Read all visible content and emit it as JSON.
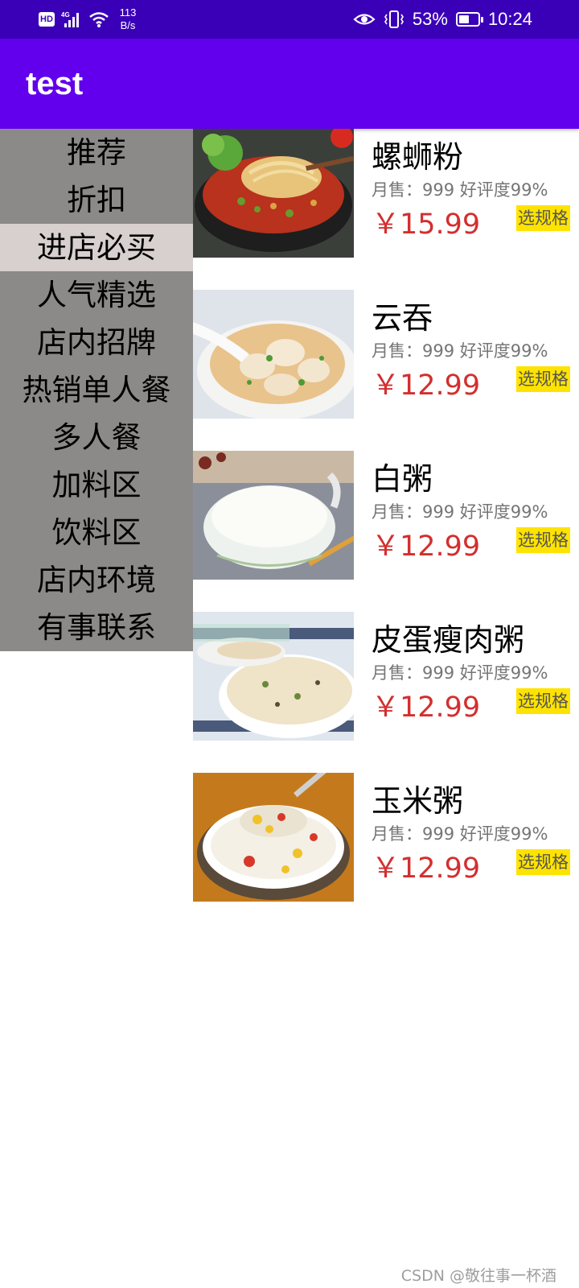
{
  "status_bar": {
    "hd": "HD",
    "net_speed_value": "113",
    "net_speed_unit": "B/s",
    "battery": "53%",
    "battery_level": 0.53,
    "time": "10:24",
    "icons": [
      "hd-icon",
      "signal-4g-icon",
      "wifi-icon",
      "eye-icon",
      "vibrate-icon",
      "battery-icon"
    ]
  },
  "app_bar": {
    "title": "test",
    "color": "#6200ee"
  },
  "categories": [
    {
      "label": "推荐"
    },
    {
      "label": "折扣"
    },
    {
      "label": "进店必买"
    },
    {
      "label": "人气精选"
    },
    {
      "label": "店内招牌"
    },
    {
      "label": "热销单人餐"
    },
    {
      "label": "多人餐"
    },
    {
      "label": "加料区"
    },
    {
      "label": "饮料区"
    },
    {
      "label": "店内环境"
    },
    {
      "label": "有事联系"
    }
  ],
  "selected_category": "进店必买",
  "foods": [
    {
      "name": "螺蛳粉",
      "stats": "月售：999 好评度99%",
      "price": "￥15.99",
      "button": "选规格",
      "image": "luosifen-photo"
    },
    {
      "name": "云吞",
      "stats": "月售：999 好评度99%",
      "price": "￥12.99",
      "button": "选规格",
      "image": "wonton-photo"
    },
    {
      "name": "白粥",
      "stats": "月售：999 好评度99%",
      "price": "￥12.99",
      "button": "选规格",
      "image": "plain-congee-photo"
    },
    {
      "name": "皮蛋瘦肉粥",
      "stats": "月售：999 好评度99%",
      "price": "￥12.99",
      "button": "选规格",
      "image": "century-egg-congee-photo"
    },
    {
      "name": "玉米粥",
      "stats": "月售：999 好评度99%",
      "price": "￥12.99",
      "button": "选规格",
      "image": "corn-congee-photo"
    }
  ],
  "watermark": "CSDN @敬往事一杯酒",
  "colors": {
    "status_bar": "#3a00b8",
    "price": "#d32f2f",
    "spec_button": "#ffe300",
    "category_bg": "#8c8a89",
    "category_selected": "#d8cfcf"
  }
}
